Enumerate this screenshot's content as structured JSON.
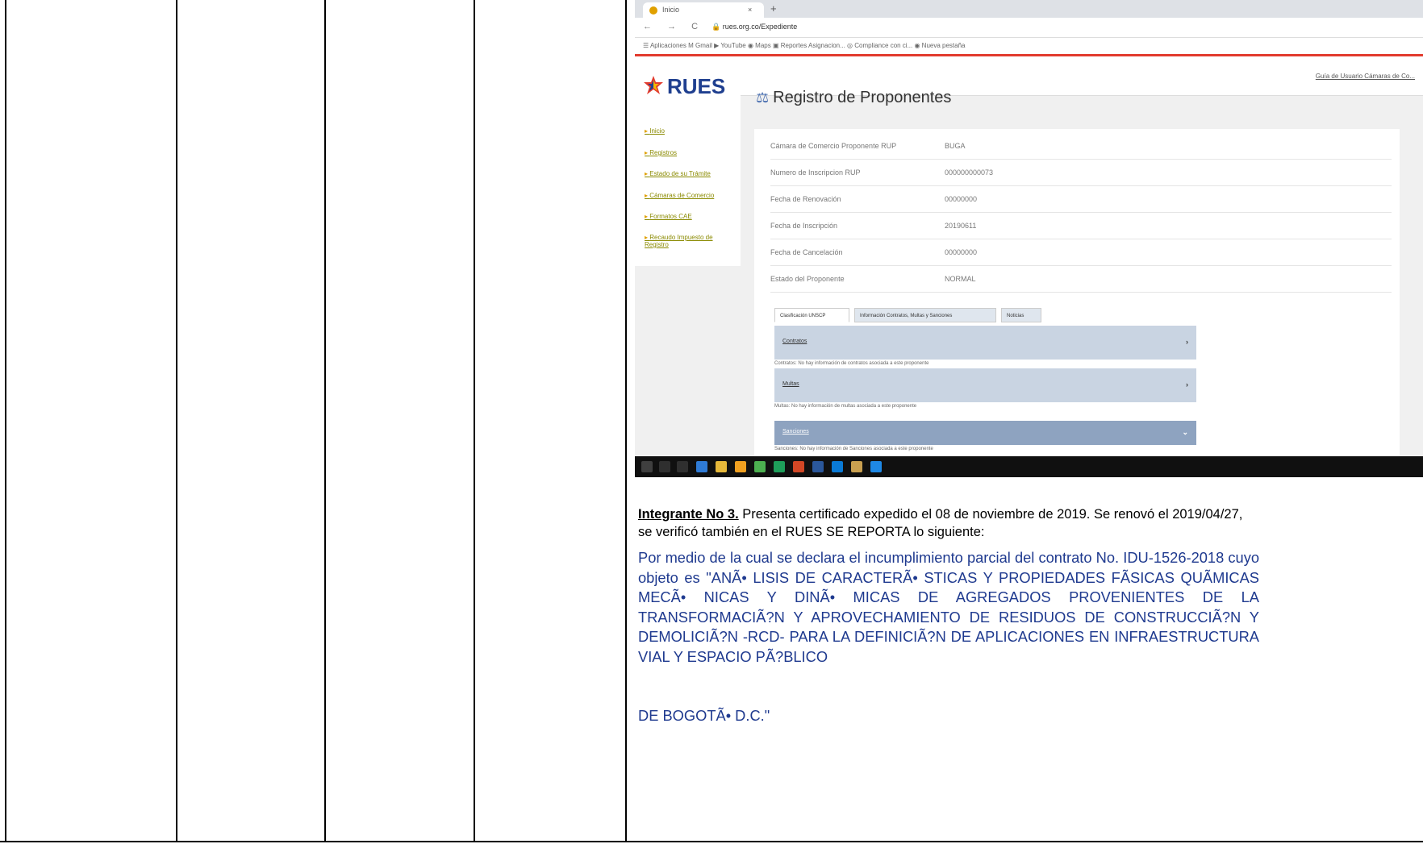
{
  "browser": {
    "tab_title": "Inicio",
    "tab_close": "×",
    "new_tab": "+",
    "nav_controls": "← → C",
    "url": "🔒 rues.org.co/Expediente",
    "bookmarks": "☰ Aplicaciones   M Gmail   ▶ YouTube   ◉ Maps   ▣ Reportes Asignacion...   ◎ Compliance con ci...   ◉ Nueva pestaña"
  },
  "rues": {
    "logo_text": "RUES",
    "top_links": "Guía de Usuario     Cámaras de Co...",
    "side_links": [
      "Inicio",
      "Registros",
      "Estado de su Trámite",
      "Cámaras de Comercio",
      "Formatos CAE",
      "Recaudo Impuesto de Registro"
    ],
    "page_title": "Registro de Proponentes",
    "fields": [
      {
        "label": "Cámara de Comercio Proponente RUP",
        "value": "BUGA"
      },
      {
        "label": "Numero de Inscripcion RUP",
        "value": "000000000073"
      },
      {
        "label": "Fecha de Renovación",
        "value": "00000000"
      },
      {
        "label": "Fecha de Inscripción",
        "value": "20190611"
      },
      {
        "label": "Fecha de Cancelación",
        "value": "00000000"
      },
      {
        "label": "Estado del Proponente",
        "value": "NORMAL"
      }
    ],
    "tabs": [
      "Clasificación UNSCP",
      "Información Contratos, Multas y Sanciones",
      "Noticias"
    ],
    "sections": [
      {
        "title": "Contratos",
        "body": "Contratos: No hay información de contratos asociada a este proponente"
      },
      {
        "title": "Multas",
        "body": "Multas: No hay información de multas asociada a este proponente"
      },
      {
        "title": "Sanciones",
        "body": "Sanciones: No hay información de Sanciones asociada a este proponente"
      }
    ]
  },
  "caption": {
    "lead": "Integrante No 3.",
    "text": " Presenta certificado expedido el 08 de noviembre de 2019. Se renovó el 2019/04/27, se verificó también en el RUES SE REPORTA lo siguiente:"
  },
  "quote": {
    "body": "Por medio de la cual se declara el incumplimiento parcial del contrato No. IDU-1526-2018 cuyo objeto es \"ANÃ• LISIS DE CARACTERÃ• STICAS Y PROPIEDADES FÃSICAS QUÃMICAS MECÃ• NICAS Y DINÃ• MICAS DE AGREGADOS PROVENIENTES DE LA TRANSFORMACIÃ?N Y APROVECHAMIENTO DE RESIDUOS DE CONSTRUCCIÃ?N Y DEMOLICIÃ?N -RCD- PARA LA DEFINICIÃ?N DE APLICACIONES EN INFRAESTRUCTURA VIAL Y ESPACIO PÃ?BLICO",
    "end": "DE BOGOTÃ•  D.C.\""
  },
  "colors": {
    "quote": "#1f3a8f",
    "rues_blue": "#1f3f8f",
    "accent_red": "#e23b2e"
  }
}
